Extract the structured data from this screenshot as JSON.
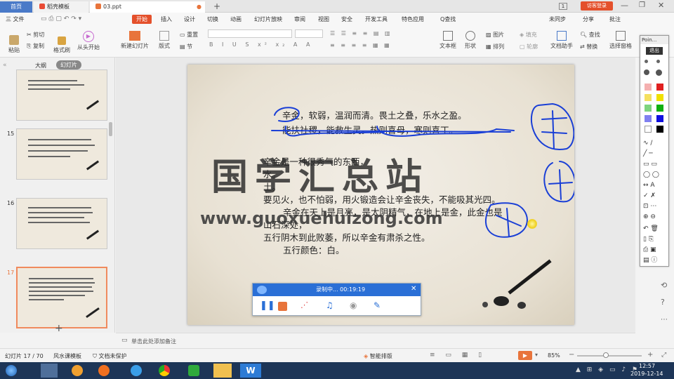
{
  "tabs": [
    {
      "label": "首页"
    },
    {
      "label": "稻壳模板"
    },
    {
      "label": "03.ppt"
    }
  ],
  "tabbar_right": {
    "badge": "1",
    "visitor": "访客登录"
  },
  "menu": [
    "三 文件",
    "开始",
    "插入",
    "设计",
    "切换",
    "动画",
    "幻灯片放映",
    "审阅",
    "视图",
    "安全",
    "开发工具",
    "特色应用",
    "Q查找"
  ],
  "menu_right": [
    "未同步",
    "分享",
    "批注"
  ],
  "ribbon": {
    "cut": "剪切",
    "copy": "复制",
    "paste": "粘贴",
    "format": "格式刷",
    "from_start": "从头开始",
    "new_slide": "新建幻灯片",
    "layout": "版式",
    "reset": "重置",
    "section": "节",
    "textbox": "文本框",
    "shape": "形状",
    "arrange": "排列",
    "picture": "图片",
    "fill": "填充",
    "outline": "轮廓",
    "find": "查找",
    "replace": "替换",
    "doc_assistant": "文档助手",
    "select_pane": "选择窗格"
  },
  "panel_tabs": [
    "大纲",
    "幻灯片"
  ],
  "thumbs": [
    {
      "num": ""
    },
    {
      "num": "15"
    },
    {
      "num": "16"
    },
    {
      "num": "17"
    }
  ],
  "slide": {
    "line1": "辛金，软弱，温润而清。畏土之叠，乐水之盈。",
    "line2": "能扶社稷，能救生灵。热则喜母，寒则喜丁。",
    "p1a": "辛金是一种很秀气的东西，",
    "p1b": "水。",
    "p1c": "土。",
    "p1d": "要见火，也不怕弱，用火锻造会让辛金丧失，不能吸其光四。",
    "p2": "辛金在天上是月亮，是太阴精气，在地上是金，此金也是",
    "p3": "山石深处，",
    "p4": "五行阴木到此败萎，所以辛金有肃杀之性。",
    "p5": "五行颜色：白。",
    "watermark_big": "国学汇总站",
    "watermark_url": "www.guoxuehuizong.com"
  },
  "recorder": {
    "status": "录制中... 00:19:19"
  },
  "pointer_panel": {
    "title": "Poin...",
    "exit": "退出"
  },
  "notes": "单击此处添加备注",
  "status": {
    "slide": "幻灯片 17 / 70",
    "theme": "风水课模板",
    "protect": "文档未保护",
    "smart": "智能排版",
    "zoom": "85%"
  },
  "taskbar": {
    "time": "12:57",
    "date": "2019-12-14"
  }
}
